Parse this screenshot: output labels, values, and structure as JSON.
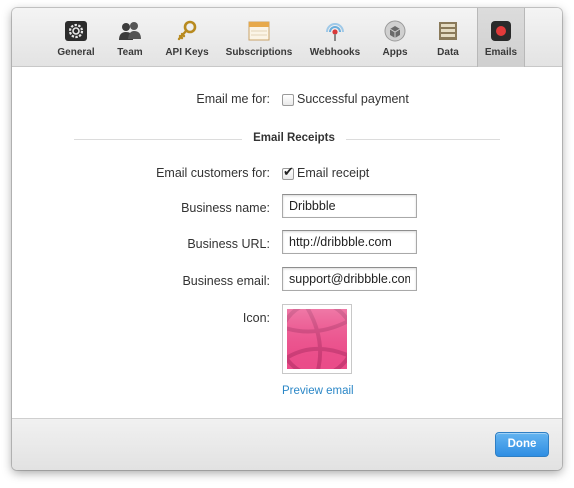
{
  "toolbar": {
    "tabs": [
      {
        "label": "General",
        "icon": "gear-icon"
      },
      {
        "label": "Team",
        "icon": "team-icon"
      },
      {
        "label": "API Keys",
        "icon": "key-icon"
      },
      {
        "label": "Subscriptions",
        "icon": "calendar-icon"
      },
      {
        "label": "Webhooks",
        "icon": "webhook-icon"
      },
      {
        "label": "Apps",
        "icon": "apps-icon"
      },
      {
        "label": "Data",
        "icon": "data-icon"
      },
      {
        "label": "Emails",
        "icon": "record-icon"
      }
    ],
    "active_tab": "Emails"
  },
  "email_me": {
    "label": "Email me for:",
    "option": "Successful payment",
    "checked": false
  },
  "section_title": "Email Receipts",
  "receipts": {
    "customers_label": "Email customers for:",
    "customers_option": "Email receipt",
    "customers_checked": true,
    "business_name_label": "Business name:",
    "business_name_value": "Dribbble",
    "business_url_label": "Business URL:",
    "business_url_value": "http://dribbble.com",
    "business_email_label": "Business email:",
    "business_email_value": "support@dribbble.com",
    "icon_label": "Icon:",
    "preview_link": "Preview email"
  },
  "footer": {
    "done_label": "Done"
  },
  "colors": {
    "accent": "#2f8ee3",
    "link": "#2b87c7",
    "icon_pink": "#ea4c89"
  }
}
